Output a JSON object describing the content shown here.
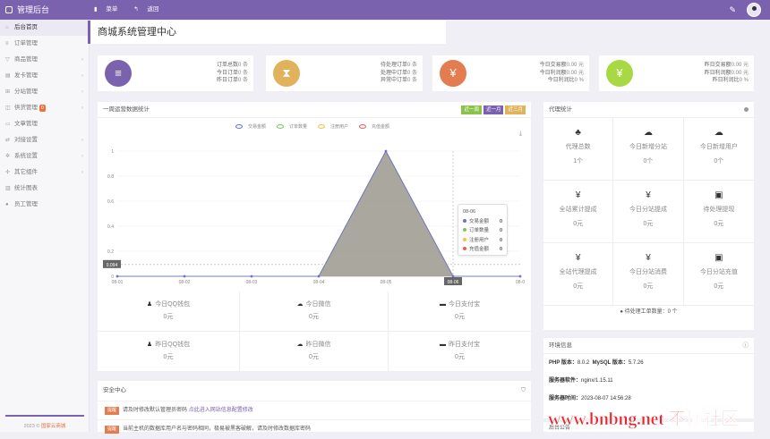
{
  "topbar": {
    "brand": "管理后台",
    "menu": "菜单",
    "back": "返回"
  },
  "sidebar": {
    "items": [
      {
        "label": "后台首页",
        "icon": "home-icon",
        "active": true,
        "arrow": false
      },
      {
        "label": "订单管理",
        "icon": "list-icon",
        "arrow": false
      },
      {
        "label": "商品管理",
        "icon": "cart-icon",
        "arrow": true
      },
      {
        "label": "发卡管理",
        "icon": "card-icon",
        "arrow": true
      },
      {
        "label": "分站管理",
        "icon": "sitemap-icon",
        "arrow": true
      },
      {
        "label": "供货管理",
        "icon": "supply-icon",
        "arrow": true,
        "badge": "0"
      },
      {
        "label": "文章管理",
        "icon": "article-icon",
        "arrow": false
      },
      {
        "label": "对接设置",
        "icon": "link-icon",
        "arrow": true
      },
      {
        "label": "系统设置",
        "icon": "gear-icon",
        "arrow": true
      },
      {
        "label": "其它组件",
        "icon": "puzzle-icon",
        "arrow": true
      },
      {
        "label": "统计图表",
        "icon": "chart-icon",
        "arrow": false
      },
      {
        "label": "员工管理",
        "icon": "user-icon",
        "arrow": false
      }
    ],
    "footer_prefix": "2023 © ",
    "footer_link": "国家云商城"
  },
  "page_title": "商城系统管理中心",
  "stats": [
    {
      "icon": "list-icon",
      "color": "#7b62ae",
      "lines": [
        {
          "label": "订单总数",
          "value": "0 条",
          "cls": ""
        },
        {
          "label": "今日订单",
          "value": "0 条",
          "cls": "cg"
        },
        {
          "label": "昨日订单",
          "value": "0 条",
          "cls": "cb"
        }
      ]
    },
    {
      "icon": "hourglass-icon",
      "color": "#e0b25b",
      "lines": [
        {
          "label": "待处理订单",
          "value": "0 条",
          "cls": "cg"
        },
        {
          "label": "处理中订单",
          "value": "0 条",
          "cls": "co"
        },
        {
          "label": "异常中订单",
          "value": "0 条",
          "cls": "cr"
        }
      ]
    },
    {
      "icon": "yen-icon",
      "color": "#e37c50",
      "lines": [
        {
          "label": "今日交易额",
          "value": "0.00 元",
          "cls": "cg"
        },
        {
          "label": "今日利润额",
          "value": "0.00 元",
          "cls": "co"
        },
        {
          "label": "今日利润比",
          "value": "0 %",
          "cls": "cb"
        }
      ]
    },
    {
      "icon": "yen-icon",
      "color": "#a7d944",
      "lines": [
        {
          "label": "昨日交易额",
          "value": "0.00 元",
          "cls": "cg"
        },
        {
          "label": "昨日利润额",
          "value": "0.00 元",
          "cls": "co"
        },
        {
          "label": "昨日利润比",
          "value": "0 %",
          "cls": "cb"
        }
      ]
    }
  ],
  "weekly": {
    "title": "一周运营数据统计",
    "buttons": [
      {
        "label": "近一周",
        "color": "#8bc34a"
      },
      {
        "label": "近一月",
        "color": "#7b62ae"
      },
      {
        "label": "近三月",
        "color": "#e0b25b"
      }
    ],
    "crosshair_value": "0.094"
  },
  "chart_data": {
    "type": "area",
    "x": [
      "08-01",
      "08-02",
      "08-03",
      "08-04",
      "08-05",
      "08-06",
      "08-0"
    ],
    "series": [
      {
        "name": "交易金额",
        "color": "#6a6fd6",
        "values": [
          0,
          0,
          0,
          0,
          1,
          0,
          0
        ]
      },
      {
        "name": "订单数量",
        "color": "#7cc75a",
        "values": [
          0,
          0,
          0,
          0,
          1,
          0,
          0
        ]
      },
      {
        "name": "注册用户",
        "color": "#f5c242",
        "values": [
          0,
          0,
          0,
          0,
          1,
          0,
          0
        ]
      },
      {
        "name": "充值金额",
        "color": "#e85d5d",
        "values": [
          0,
          0,
          0,
          0,
          1,
          0,
          0
        ]
      }
    ],
    "yticks": [
      "0",
      "0.2",
      "0.4",
      "0.6",
      "0.8",
      "1"
    ],
    "ylim": [
      0,
      1
    ]
  },
  "tooltip": {
    "title": "08-06",
    "rows": [
      {
        "label": "交易金额",
        "value": "0",
        "color": "#6a6fd6"
      },
      {
        "label": "订单数量",
        "value": "0",
        "color": "#7cc75a"
      },
      {
        "label": "注册用户",
        "value": "0",
        "color": "#f5c242"
      },
      {
        "label": "充值金额",
        "value": "0",
        "color": "#e85d5d"
      }
    ]
  },
  "wallets": [
    {
      "icon": "qq-icon",
      "glyph": "♟",
      "label": "今日QQ钱包",
      "value": "0元"
    },
    {
      "icon": "wechat-icon",
      "glyph": "☁",
      "label": "今日微信",
      "value": "0元"
    },
    {
      "icon": "alipay-icon",
      "glyph": "▬",
      "label": "今日支付宝",
      "value": "0元"
    },
    {
      "icon": "qq-icon",
      "glyph": "♟",
      "label": "昨日QQ钱包",
      "value": "0元"
    },
    {
      "icon": "wechat-icon",
      "glyph": "☁",
      "label": "昨日微信",
      "value": "0元"
    },
    {
      "icon": "alipay-icon",
      "glyph": "▬",
      "label": "昨日支付宝",
      "value": "0元"
    }
  ],
  "agent": {
    "title": "代理统计",
    "cells": [
      {
        "icon": "sitemap-icon",
        "glyph": "♣",
        "label": "代理总数",
        "value": "1个"
      },
      {
        "icon": "cloud-icon",
        "glyph": "☁",
        "label": "今日新增分站",
        "value": "0个"
      },
      {
        "icon": "cloud-icon",
        "glyph": "☁",
        "label": "今日新增用户",
        "value": "0个"
      },
      {
        "icon": "yen-icon",
        "glyph": "¥",
        "label": "全站累计提成",
        "value": "0元"
      },
      {
        "icon": "yen-icon",
        "glyph": "¥",
        "label": "今日分站提成",
        "value": "0元"
      },
      {
        "icon": "money-icon",
        "glyph": "▣",
        "label": "待处理提现",
        "value": "0元"
      },
      {
        "icon": "yen-icon",
        "glyph": "¥",
        "label": "全站代理提成",
        "value": "0元"
      },
      {
        "icon": "yen-icon",
        "glyph": "¥",
        "label": "今日分站消费",
        "value": "0元"
      },
      {
        "icon": "money-icon",
        "glyph": "▣",
        "label": "今日分站充值",
        "value": "0元"
      }
    ],
    "pending": "待处理工单数量：0 个"
  },
  "env": {
    "title": "环境信息",
    "php_label": "PHP 版本：",
    "php": "8.0.2",
    "mysql_label": "MySQL 版本：",
    "mysql": "5.7.26",
    "sw_label": "服务器软件：",
    "sw": "nginx/1.15.11",
    "time_label": "服务器时间：",
    "time": "2023-08-07 14:56:28"
  },
  "announce": {
    "title": "后台公告"
  },
  "security": {
    "title": "安全中心",
    "items": [
      {
        "tag": "提醒",
        "text": "请及时修改默认管理员密码 ",
        "link": "点此进入网站信息配置修改"
      },
      {
        "tag": "提醒",
        "text": "当前主机的数据库用户名与密码相同，极易被黑客破解，请及时修改数据库密码",
        "link": ""
      }
    ]
  },
  "watermark": "www.bnbng.net 不懂社区"
}
